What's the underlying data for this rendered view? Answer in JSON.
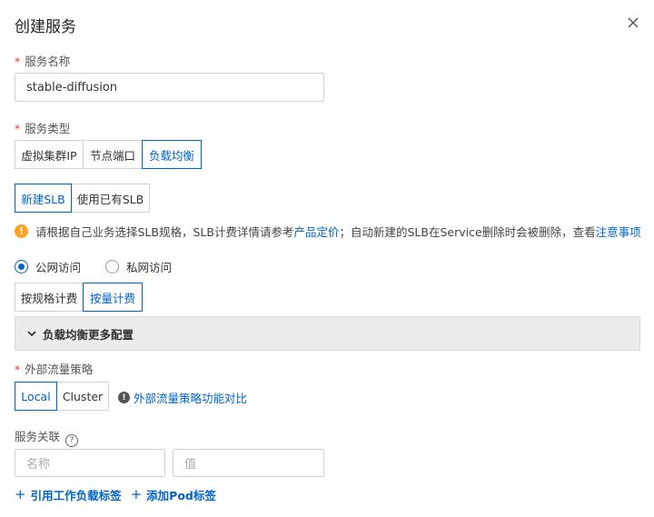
{
  "dialog": {
    "title": "创建服务"
  },
  "service_name": {
    "label": "服务名称",
    "required_mark": "*",
    "value": "stable-diffusion"
  },
  "service_type": {
    "label": "服务类型",
    "required_mark": "*",
    "options": [
      "虚拟集群IP",
      "节点端口",
      "负载均衡"
    ],
    "selected": "负载均衡"
  },
  "slb": {
    "options": [
      "新建SLB",
      "使用已有SLB"
    ],
    "selected": "新建SLB"
  },
  "notice": {
    "text1": "请根据自己业务选择SLB规格，SLB计费详情请参考",
    "link1": "产品定价",
    "text2": "；自动新建的SLB在Service删除时会被删除，查看",
    "link2": "注意事项"
  },
  "access": {
    "options": [
      "公网访问",
      "私网访问"
    ],
    "selected": "公网访问"
  },
  "billing": {
    "options": [
      "按规格计费",
      "按量计费"
    ],
    "selected": "按量计费"
  },
  "more_config": {
    "label": "负载均衡更多配置"
  },
  "traffic_policy": {
    "label": "外部流量策略",
    "required_mark": "*",
    "options": [
      "Local",
      "Cluster"
    ],
    "selected": "Local",
    "hint_link": "外部流量策略功能对比"
  },
  "association": {
    "label": "服务关联",
    "name_placeholder": "名称",
    "value_placeholder": "值"
  },
  "actions": {
    "add_workload_label": "引用工作负载标签",
    "add_pod_label": "添加Pod标签"
  },
  "colors": {
    "accent": "#0064c8",
    "required": "#e03a3a",
    "warning": "#f5a623"
  }
}
